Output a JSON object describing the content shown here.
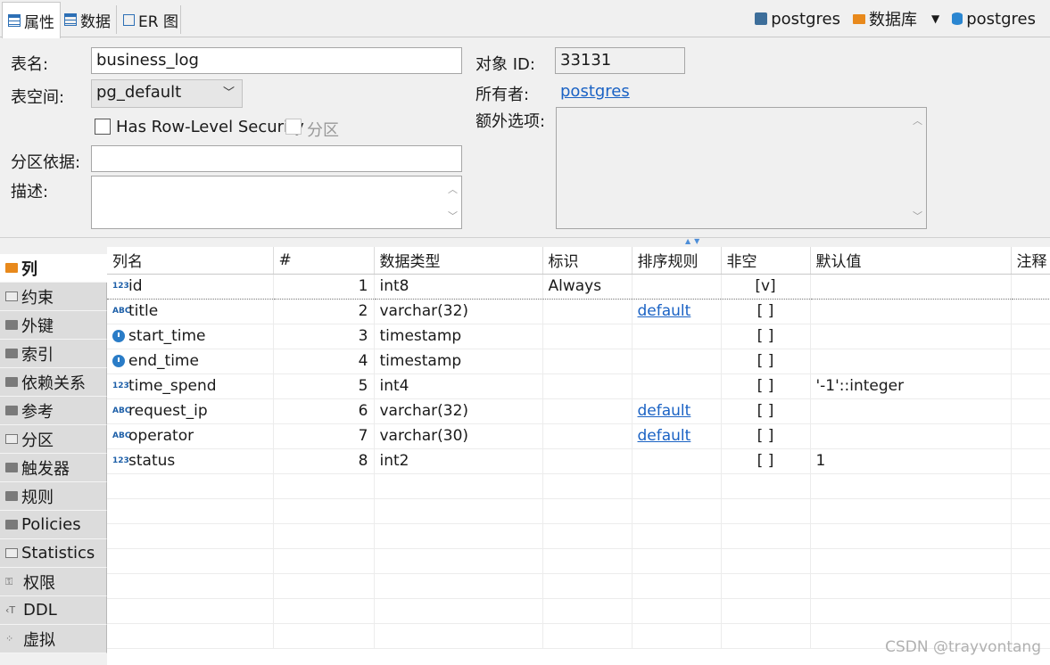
{
  "tabs": [
    {
      "label": "属性",
      "icon": "properties-icon",
      "active": true
    },
    {
      "label": "数据",
      "icon": "data-icon",
      "active": false
    },
    {
      "label": "ER 图",
      "icon": "er-diagram-icon",
      "active": false
    }
  ],
  "breadcrumb": {
    "connection": "postgres",
    "database_folder": "数据库",
    "database": "postgres"
  },
  "form": {
    "table_name_label": "表名:",
    "table_name_value": "business_log",
    "tablespace_label": "表空间:",
    "tablespace_value": "pg_default",
    "rls_label": "Has Row-Level Security",
    "partition_label": "分区",
    "partition_by_label": "分区依据:",
    "partition_by_value": "",
    "description_label": "描述:",
    "object_id_label": "对象 ID:",
    "object_id_value": "33131",
    "owner_label": "所有者:",
    "owner_value": "postgres",
    "extra_options_label": "额外选项:"
  },
  "side_tabs": [
    {
      "label": "列",
      "icon": "folder-icon",
      "active": true
    },
    {
      "label": "约束",
      "icon": "constraint-icon"
    },
    {
      "label": "外键",
      "icon": "folder-icon"
    },
    {
      "label": "索引",
      "icon": "folder-icon"
    },
    {
      "label": "依赖关系",
      "icon": "folder-icon"
    },
    {
      "label": "参考",
      "icon": "folder-icon"
    },
    {
      "label": "分区",
      "icon": "partition-icon"
    },
    {
      "label": "触发器",
      "icon": "folder-icon"
    },
    {
      "label": "规则",
      "icon": "folder-icon"
    },
    {
      "label": "Policies",
      "icon": "folder-icon"
    },
    {
      "label": "Statistics",
      "icon": "info-icon"
    },
    {
      "label": "权限",
      "icon": "key-icon"
    },
    {
      "label": "DDL",
      "icon": "ddl-icon"
    },
    {
      "label": "虚拟",
      "icon": "virtual-icon"
    }
  ],
  "columns_table": {
    "headers": [
      "列名",
      "#",
      "数据类型",
      "标识",
      "排序规则",
      "非空",
      "默认值",
      "注释"
    ],
    "rows": [
      {
        "type_icon": "123",
        "name": "id",
        "num": "1",
        "dtype": "int8",
        "identity": "Always",
        "collation": "",
        "notnull": "[v]",
        "default": "",
        "comment": ""
      },
      {
        "type_icon": "ABC",
        "name": "title",
        "num": "2",
        "dtype": "varchar(32)",
        "identity": "",
        "collation": "default",
        "notnull": "[ ]",
        "default": "",
        "comment": ""
      },
      {
        "type_icon": "clock",
        "name": "start_time",
        "num": "3",
        "dtype": "timestamp",
        "identity": "",
        "collation": "",
        "notnull": "[ ]",
        "default": "",
        "comment": ""
      },
      {
        "type_icon": "clock",
        "name": "end_time",
        "num": "4",
        "dtype": "timestamp",
        "identity": "",
        "collation": "",
        "notnull": "[ ]",
        "default": "",
        "comment": ""
      },
      {
        "type_icon": "123",
        "name": "time_spend",
        "num": "5",
        "dtype": "int4",
        "identity": "",
        "collation": "",
        "notnull": "[ ]",
        "default": "'-1'::integer",
        "comment": ""
      },
      {
        "type_icon": "ABC",
        "name": "request_ip",
        "num": "6",
        "dtype": "varchar(32)",
        "identity": "",
        "collation": "default",
        "notnull": "[ ]",
        "default": "",
        "comment": ""
      },
      {
        "type_icon": "ABC",
        "name": "operator",
        "num": "7",
        "dtype": "varchar(30)",
        "identity": "",
        "collation": "default",
        "notnull": "[ ]",
        "default": "",
        "comment": ""
      },
      {
        "type_icon": "123",
        "name": "status",
        "num": "8",
        "dtype": "int2",
        "identity": "",
        "collation": "",
        "notnull": "[ ]",
        "default": "1",
        "comment": ""
      }
    ]
  },
  "watermark": "CSDN @trayvontang"
}
